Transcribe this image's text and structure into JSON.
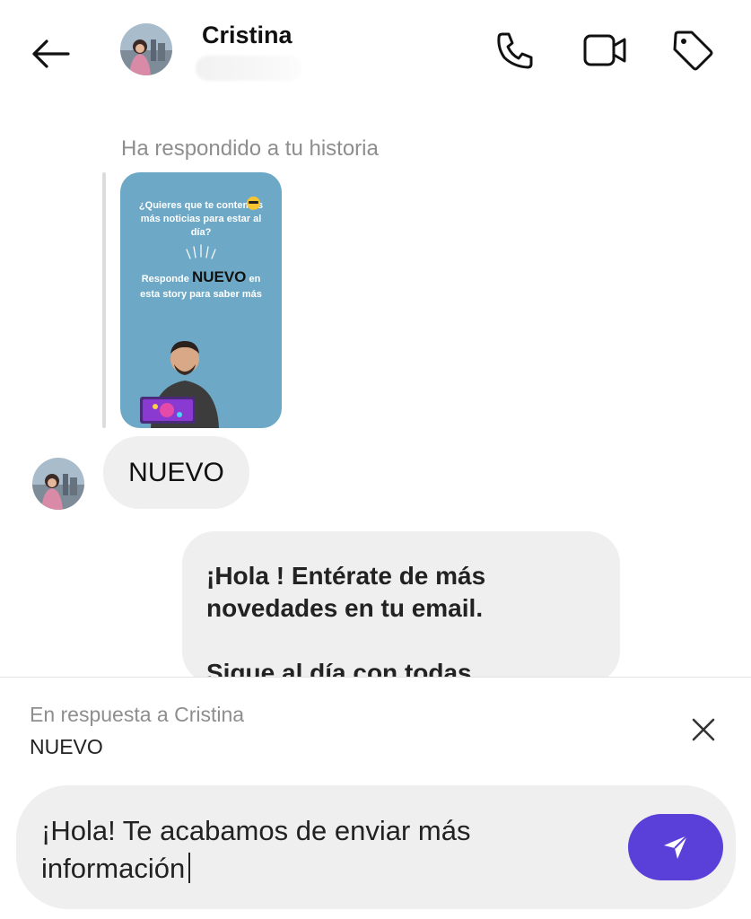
{
  "header": {
    "contact_name": "Cristina",
    "icons": [
      "back-arrow-icon",
      "phone-icon",
      "video-camera-icon",
      "tag-icon"
    ]
  },
  "story": {
    "note": "Ha respondido a tu historia",
    "line1": "¿Quieres que te contemos más noticias para estar al día?",
    "line2_prefix": "Responde",
    "line2_keyword": "NUEVO",
    "line2_suffix": "en",
    "line3": "esta story para saber más",
    "background_color": "#6da9c6"
  },
  "messages": {
    "incoming_text": "NUEVO",
    "outgoing_line1": "¡Hola ! Entérate de más",
    "outgoing_line2": "novedades en tu email.",
    "outgoing_line3": "Sigue al día con todas"
  },
  "composer": {
    "reply_to_label": "En respuesta a Cristina",
    "reply_quote": "NUEVO",
    "draft_line1": "¡Hola! Te acabamos de enviar más",
    "draft_line2": "información",
    "send_color": "#5a3fd9"
  }
}
